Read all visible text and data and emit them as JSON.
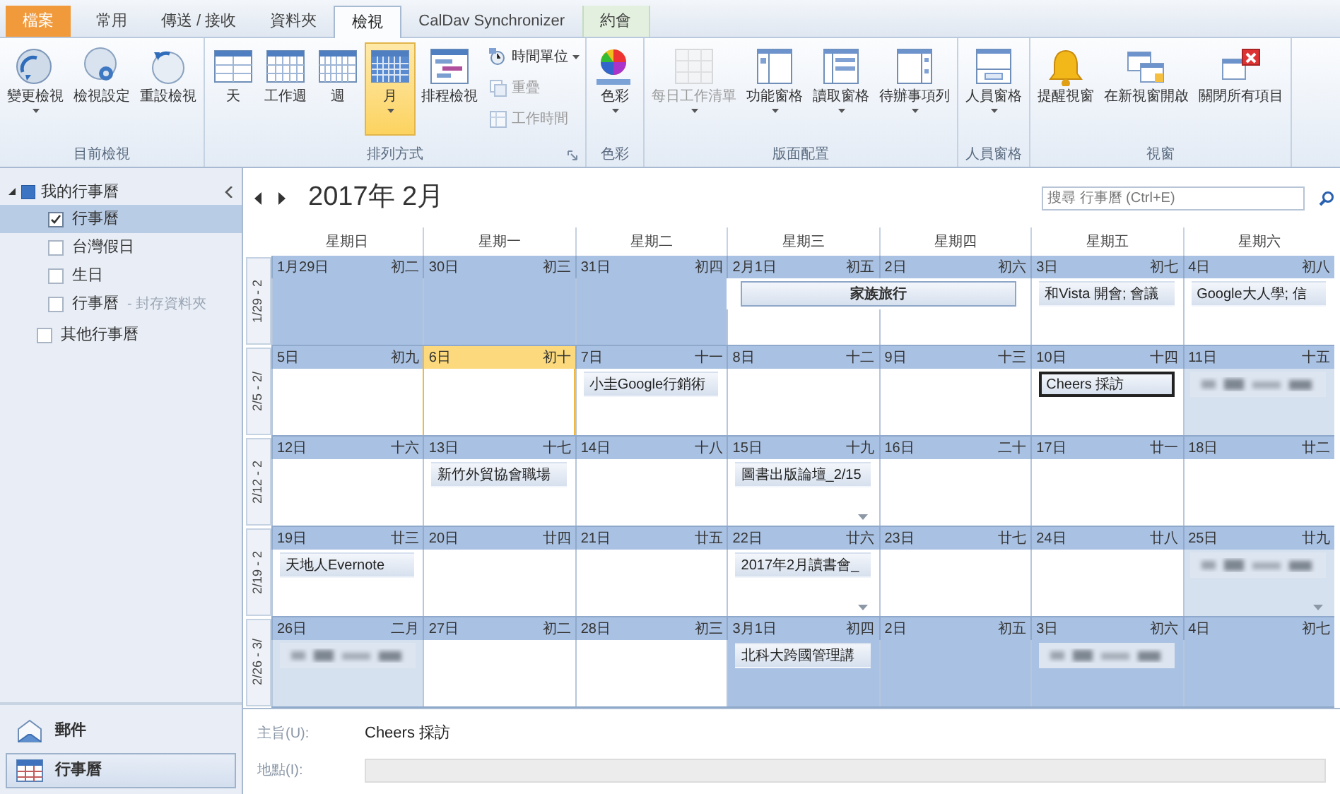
{
  "tabs": [
    {
      "label": "檔案",
      "kind": "file",
      "selected": false
    },
    {
      "label": "常用",
      "kind": "normal",
      "selected": false
    },
    {
      "label": "傳送 / 接收",
      "kind": "normal",
      "selected": false
    },
    {
      "label": "資料夾",
      "kind": "normal",
      "selected": false
    },
    {
      "label": "檢視",
      "kind": "normal",
      "selected": true
    },
    {
      "label": "CalDav Synchronizer",
      "kind": "normal",
      "selected": false
    },
    {
      "label": "約會",
      "kind": "contextual",
      "selected": false
    }
  ],
  "ribbon": [
    {
      "label": "目前檢視",
      "launcher": false,
      "buttons": [
        {
          "label": "變更檢視",
          "menu": true,
          "selected": false,
          "disabled": false
        },
        {
          "label": "檢視設定",
          "menu": false,
          "selected": false,
          "disabled": false
        },
        {
          "label": "重設檢視",
          "menu": false,
          "selected": false,
          "disabled": false
        }
      ]
    },
    {
      "label": "排列方式",
      "launcher": true,
      "buttons": [
        {
          "label": "天",
          "menu": false,
          "selected": false,
          "disabled": false
        },
        {
          "label": "工作週",
          "menu": false,
          "selected": false,
          "disabled": false
        },
        {
          "label": "週",
          "menu": false,
          "selected": false,
          "disabled": false
        },
        {
          "label": "月",
          "menu": true,
          "selected": true,
          "disabled": false
        },
        {
          "label": "排程檢視",
          "menu": false,
          "selected": false,
          "disabled": false
        }
      ],
      "small_buttons": [
        {
          "label": "時間單位",
          "menu": true,
          "disabled": false
        },
        {
          "label": "重疊",
          "menu": false,
          "disabled": true
        },
        {
          "label": "工作時間",
          "menu": false,
          "disabled": true
        }
      ]
    },
    {
      "label": "色彩",
      "launcher": false,
      "buttons": [
        {
          "label": "色彩",
          "menu": true,
          "selected": false,
          "disabled": false
        }
      ]
    },
    {
      "label": "版面配置",
      "launcher": false,
      "buttons": [
        {
          "label": "每日工作清單",
          "menu": true,
          "selected": false,
          "disabled": true
        },
        {
          "label": "功能窗格",
          "menu": true,
          "selected": false,
          "disabled": false
        },
        {
          "label": "讀取窗格",
          "menu": true,
          "selected": false,
          "disabled": false
        },
        {
          "label": "待辦事項列",
          "menu": true,
          "selected": false,
          "disabled": false
        }
      ]
    },
    {
      "label": "人員窗格",
      "launcher": false,
      "buttons": [
        {
          "label": "人員窗格",
          "menu": true,
          "selected": false,
          "disabled": false
        }
      ]
    },
    {
      "label": "視窗",
      "launcher": false,
      "buttons": [
        {
          "label": "提醒視窗",
          "menu": false,
          "selected": false,
          "disabled": false
        },
        {
          "label": "在新視窗開啟",
          "menu": false,
          "selected": false,
          "disabled": false
        },
        {
          "label": "關閉所有項目",
          "menu": false,
          "selected": false,
          "disabled": false
        }
      ]
    }
  ],
  "sidebar": {
    "group": {
      "label": "我的行事曆",
      "expanded": true,
      "children": [
        {
          "label": "行事曆",
          "checked": true,
          "selected": true
        },
        {
          "label": "台灣假日",
          "checked": false,
          "selected": false
        },
        {
          "label": "生日",
          "checked": false,
          "selected": false
        },
        {
          "label": "行事曆",
          "note": "- 封存資料夾",
          "checked": false,
          "selected": false
        }
      ]
    },
    "other": {
      "label": "其他行事曆",
      "checked": false
    },
    "nav": [
      {
        "label": "郵件",
        "selected": false
      },
      {
        "label": "行事曆",
        "selected": true
      }
    ]
  },
  "calendar": {
    "title": "2017年 2月",
    "search": {
      "placeholder": "搜尋 行事曆 (Ctrl+E)"
    },
    "weekdays": [
      "星期日",
      "星期一",
      "星期二",
      "星期三",
      "星期四",
      "星期五",
      "星期六"
    ],
    "weeks": [
      {
        "label": "1/29 - 2",
        "days": [
          {
            "date": "1月29日",
            "lunar": "初二",
            "other_month": true,
            "today": false,
            "more": false
          },
          {
            "date": "30日",
            "lunar": "初三",
            "other_month": true,
            "today": false,
            "more": false
          },
          {
            "date": "31日",
            "lunar": "初四",
            "other_month": true,
            "today": false,
            "more": false
          },
          {
            "date": "2月1日",
            "lunar": "初五",
            "other_month": false,
            "today": false,
            "more": false,
            "events": [
              {
                "text": "家族旅行",
                "kind": "all_day",
                "selected": false
              }
            ]
          },
          {
            "date": "2日",
            "lunar": "初六",
            "other_month": false,
            "today": false,
            "more": false,
            "spanned": true
          },
          {
            "date": "3日",
            "lunar": "初七",
            "other_month": false,
            "today": false,
            "more": false,
            "events": [
              {
                "text": "和Vista 開會; 會議",
                "kind": "timed",
                "selected": false
              }
            ]
          },
          {
            "date": "4日",
            "lunar": "初八",
            "other_month": false,
            "today": false,
            "more": false,
            "events": [
              {
                "text": "Google大人學; 信",
                "kind": "timed",
                "selected": false
              }
            ]
          }
        ]
      },
      {
        "label": "2/5 - 2/",
        "days": [
          {
            "date": "5日",
            "lunar": "初九",
            "other_month": false,
            "today": false,
            "more": false
          },
          {
            "date": "6日",
            "lunar": "初十",
            "other_month": false,
            "today": true,
            "more": false
          },
          {
            "date": "7日",
            "lunar": "十一",
            "other_month": false,
            "today": false,
            "more": false,
            "events": [
              {
                "text": "小圭Google行銷術",
                "kind": "timed",
                "selected": false
              }
            ]
          },
          {
            "date": "8日",
            "lunar": "十二",
            "other_month": false,
            "today": false,
            "more": false
          },
          {
            "date": "9日",
            "lunar": "十三",
            "other_month": false,
            "today": false,
            "more": false
          },
          {
            "date": "10日",
            "lunar": "十四",
            "other_month": false,
            "today": false,
            "more": false,
            "events": [
              {
                "text": "Cheers 採訪",
                "kind": "timed",
                "selected": true
              }
            ]
          },
          {
            "date": "11日",
            "lunar": "十五",
            "other_month": false,
            "today": false,
            "more": false,
            "busy": true,
            "events": [
              {
                "kind": "blurred",
                "selected": false
              }
            ]
          }
        ]
      },
      {
        "label": "2/12 - 2",
        "days": [
          {
            "date": "12日",
            "lunar": "十六",
            "other_month": false,
            "today": false,
            "more": false
          },
          {
            "date": "13日",
            "lunar": "十七",
            "other_month": false,
            "today": false,
            "more": false,
            "events": [
              {
                "text": "新竹外貿協會職場",
                "kind": "timed",
                "selected": false
              }
            ]
          },
          {
            "date": "14日",
            "lunar": "十八",
            "other_month": false,
            "today": false,
            "more": false
          },
          {
            "date": "15日",
            "lunar": "十九",
            "other_month": false,
            "today": false,
            "more": true,
            "events": [
              {
                "text": "圖書出版論壇_2/15",
                "kind": "timed",
                "selected": false
              }
            ]
          },
          {
            "date": "16日",
            "lunar": "二十",
            "other_month": false,
            "today": false,
            "more": false
          },
          {
            "date": "17日",
            "lunar": "廿一",
            "other_month": false,
            "today": false,
            "more": false
          },
          {
            "date": "18日",
            "lunar": "廿二",
            "other_month": false,
            "today": false,
            "more": false
          }
        ]
      },
      {
        "label": "2/19 - 2",
        "days": [
          {
            "date": "19日",
            "lunar": "廿三",
            "other_month": false,
            "today": false,
            "more": false,
            "events": [
              {
                "text": "天地人Evernote",
                "kind": "timed",
                "selected": false
              }
            ]
          },
          {
            "date": "20日",
            "lunar": "廿四",
            "other_month": false,
            "today": false,
            "more": false
          },
          {
            "date": "21日",
            "lunar": "廿五",
            "other_month": false,
            "today": false,
            "more": false
          },
          {
            "date": "22日",
            "lunar": "廿六",
            "other_month": false,
            "today": false,
            "more": true,
            "events": [
              {
                "text": "2017年2月讀書會_",
                "kind": "timed",
                "selected": false
              }
            ]
          },
          {
            "date": "23日",
            "lunar": "廿七",
            "other_month": false,
            "today": false,
            "more": false
          },
          {
            "date": "24日",
            "lunar": "廿八",
            "other_month": false,
            "today": false,
            "more": false
          },
          {
            "date": "25日",
            "lunar": "廿九",
            "other_month": false,
            "today": false,
            "more": true,
            "busy": true,
            "events": [
              {
                "kind": "blurred",
                "selected": false
              }
            ]
          }
        ]
      },
      {
        "label": "2/26 - 3/",
        "days": [
          {
            "date": "26日",
            "lunar": "二月",
            "other_month": false,
            "today": false,
            "more": false,
            "busy": true,
            "events": [
              {
                "kind": "blurred",
                "selected": false
              }
            ]
          },
          {
            "date": "27日",
            "lunar": "初二",
            "other_month": false,
            "today": false,
            "more": false
          },
          {
            "date": "28日",
            "lunar": "初三",
            "other_month": false,
            "today": false,
            "more": false
          },
          {
            "date": "3月1日",
            "lunar": "初四",
            "other_month": true,
            "today": false,
            "more": false,
            "events": [
              {
                "text": "北科大跨國管理講",
                "kind": "timed",
                "selected": false
              }
            ]
          },
          {
            "date": "2日",
            "lunar": "初五",
            "other_month": true,
            "today": false,
            "more": false
          },
          {
            "date": "3日",
            "lunar": "初六",
            "other_month": true,
            "today": false,
            "more": false,
            "events": [
              {
                "kind": "blurred",
                "selected": false
              }
            ]
          },
          {
            "date": "4日",
            "lunar": "初七",
            "other_month": true,
            "today": false,
            "more": false
          }
        ]
      }
    ]
  },
  "details": {
    "subject": {
      "label": "主旨(U):",
      "value": "Cheers 採訪"
    },
    "location": {
      "label": "地點(I):"
    }
  }
}
